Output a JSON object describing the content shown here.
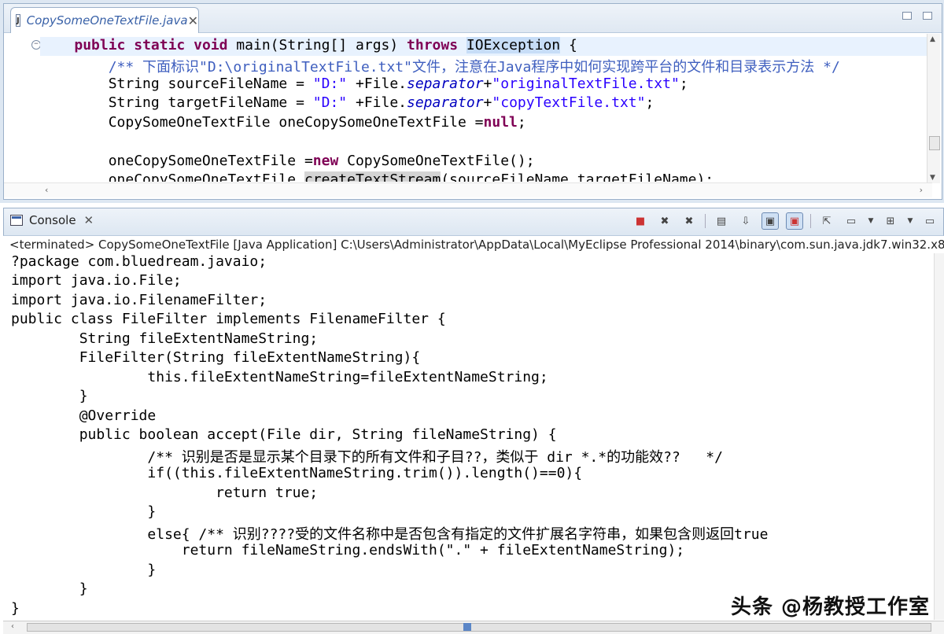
{
  "editor": {
    "tab_title": "CopySomeOneTextFile.java",
    "tab_icon": "java-file-icon",
    "lines": [
      "    public static void main(String[] args) throws IOException {",
      "        /** 下面标识\"D:\\originalTextFile.txt\"文件，注意在Java程序中如何实现跨平台的文件和目录表示方法 */",
      "        String sourceFileName = \"D:\" +File.separator+\"originalTextFile.txt\";",
      "        String targetFileName = \"D:\" +File.separator+\"copyTextFile.txt\";",
      "        CopySomeOneTextFile oneCopySomeOneTextFile =null;",
      "",
      "        oneCopySomeOneTextFile =new CopySomeOneTextFile();",
      "        oneCopySomeOneTextFile.createTextStream(sourceFileName,targetFileName);"
    ]
  },
  "console": {
    "tab_label": "Console",
    "launch_info": "<terminated> CopySomeOneTextFile [Java Application] C:\\Users\\Administrator\\AppData\\Local\\MyEclipse Professional 2014\\binary\\com.sun.java.jdk7.win32.x86",
    "lines": [
      "?package com.bluedream.javaio;",
      "import java.io.File;",
      "import java.io.FilenameFilter;",
      "public class FileFilter implements FilenameFilter {",
      "        String fileExtentNameString;",
      "        FileFilter(String fileExtentNameString){",
      "                this.fileExtentNameString=fileExtentNameString;",
      "        }",
      "        @Override",
      "        public boolean accept(File dir, String fileNameString) {",
      "                /** 识别是否是显示某个目录下的所有文件和子目??，类似于 dir *.*的功能效??   */",
      "                if((this.fileExtentNameString.trim()).length()==0){",
      "                        return true;",
      "                }",
      "                else{ /** 识别????受的文件名称中是否包含有指定的文件扩展名字符串，如果包含则返回true",
      "                    return fileNameString.endsWith(\".\" + fileExtentNameString);",
      "                }",
      "        }",
      "}"
    ],
    "toolbar_icons": [
      "terminate-icon",
      "remove-launch-icon",
      "remove-all-terminated-icon",
      "clear-console-icon",
      "scroll-lock-icon",
      "show-on-stdout-icon",
      "show-on-stderr-icon",
      "pin-console-icon",
      "display-selected-console-icon",
      "open-console-icon",
      "view-menu-icon",
      "minimize-icon"
    ]
  },
  "watermark": "头条 @杨教授工作室"
}
